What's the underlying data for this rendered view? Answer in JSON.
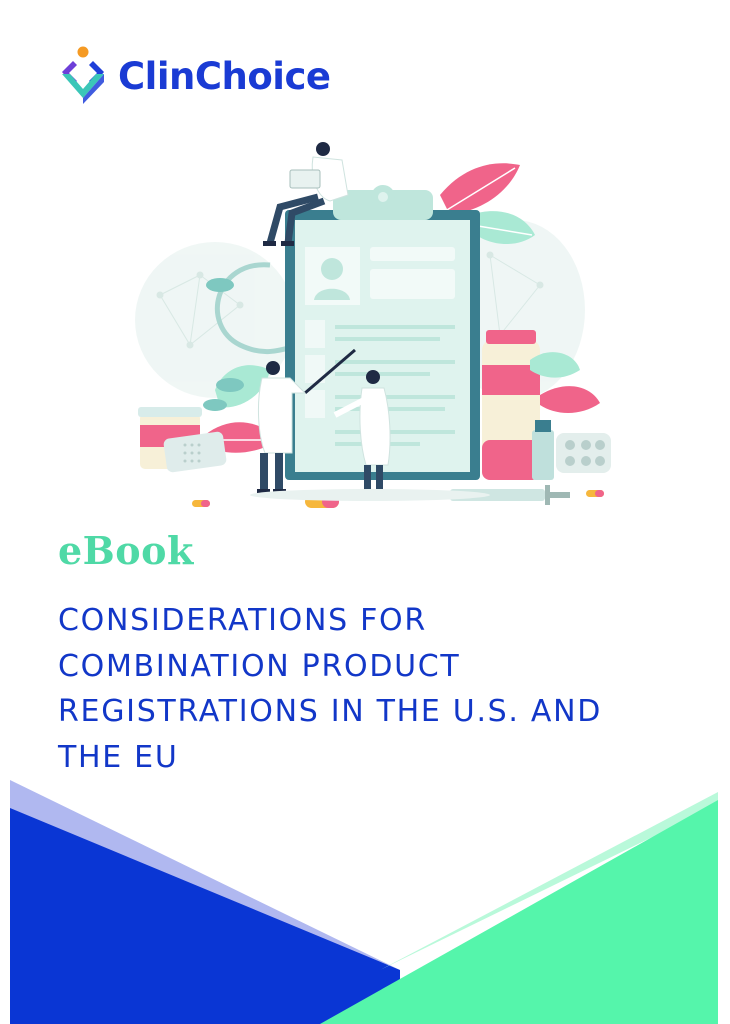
{
  "brand": {
    "name": "ClinChoice",
    "text_color": "#1a3bd4",
    "accent_blue": "#1f3fd9",
    "accent_purple": "#6d3fd8",
    "accent_teal": "#3bc6b8",
    "accent_orange": "#f59a23"
  },
  "cover": {
    "label": "eBook",
    "label_color": "#4fd9a6",
    "title_lines": [
      "CONSIDERATIONS FOR",
      "COMBINATION PRODUCT",
      "REGISTRATIONS IN THE U.S. AND",
      "THE EU"
    ],
    "title_color": "#1237c8"
  },
  "illustration": {
    "icon": "clipboard-with-doctors-illustration"
  },
  "footer": {
    "blue": "#0a36d4",
    "blue_light": "#b0b8f0",
    "green": "#55f5ab",
    "green_light": "#b9f9da"
  }
}
